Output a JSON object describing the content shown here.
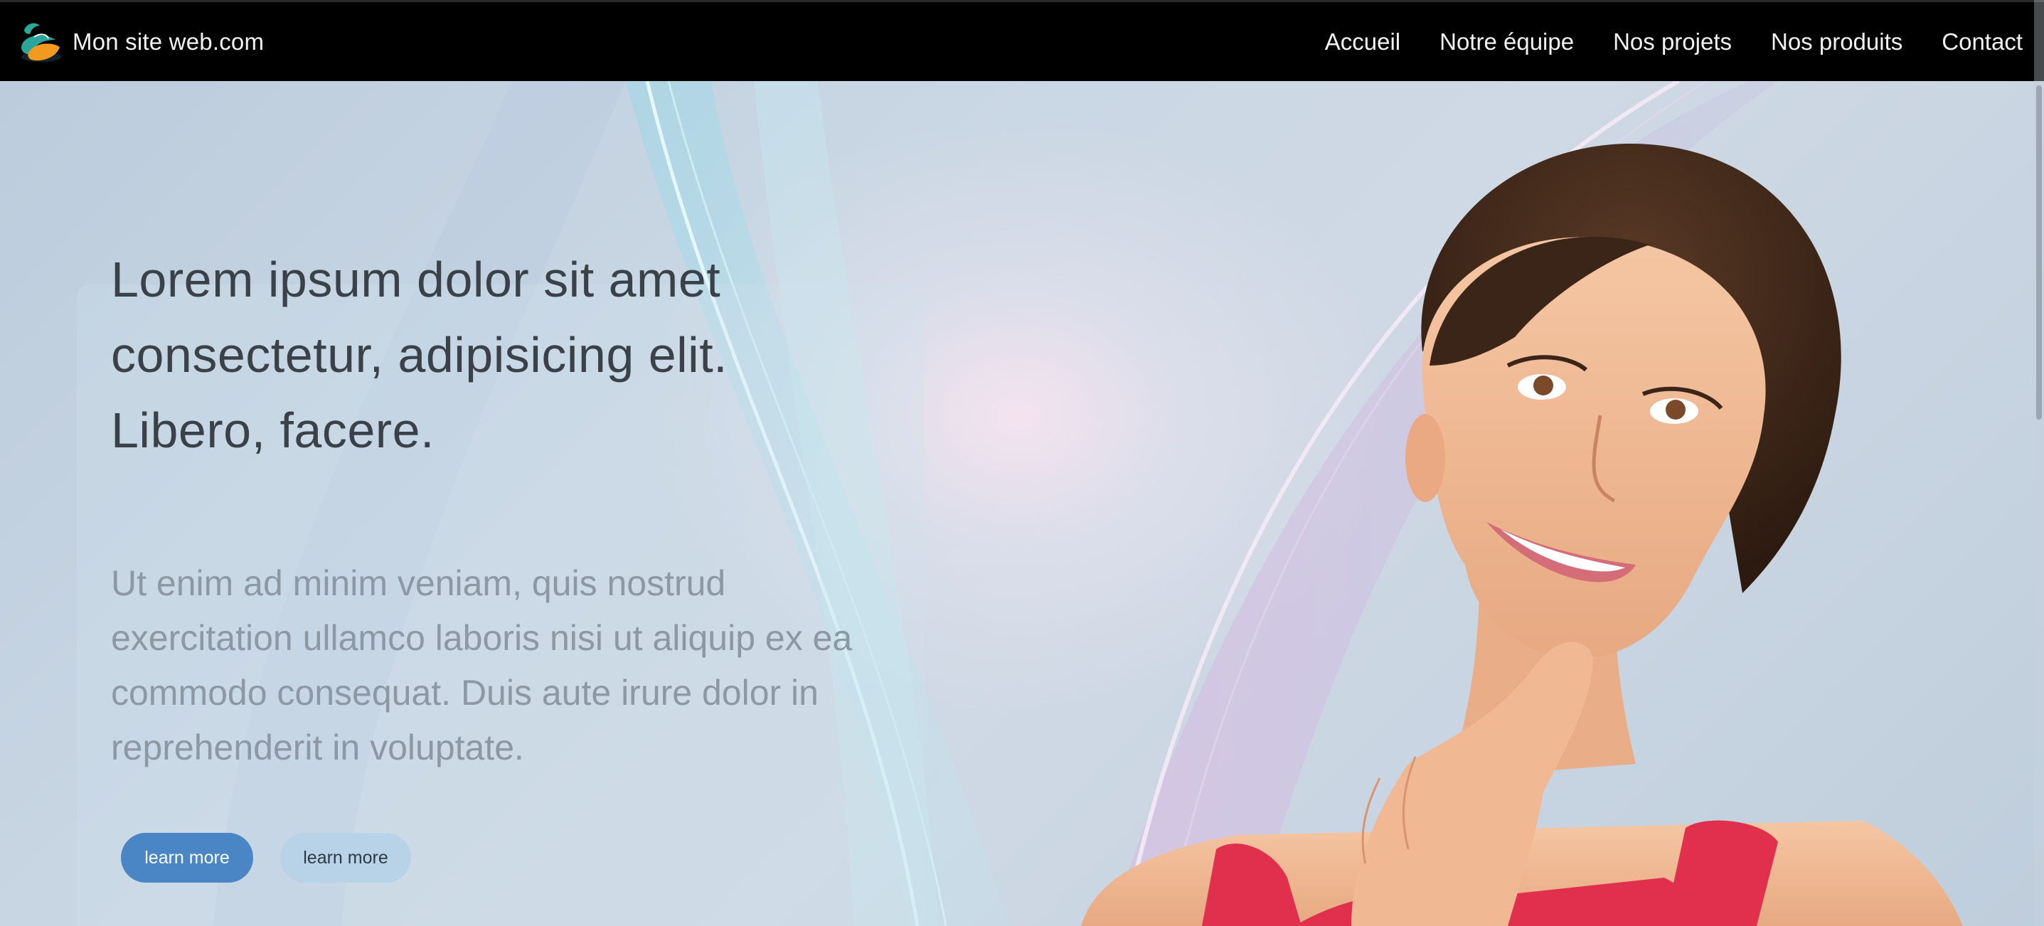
{
  "navbar": {
    "brand_text": "Mon site web.com",
    "logo_icon": "leaf-swirl-logo",
    "links": [
      "Accueil",
      "Notre équipe",
      "Nos projets",
      "Nos produits",
      "Contact"
    ]
  },
  "hero": {
    "title": "Lorem ipsum dolor sit amet consectetur, adipisicing elit. Libero, facere.",
    "text": "Ut enim ad minim veniam, quis nostrud exercitation ullamco laboris nisi ut aliquip ex ea commodo consequat. Duis aute irure dolor in reprehenderit in voluptate.",
    "primary_button": "learn more",
    "secondary_button": "learn more",
    "image": "smiling-woman-photo"
  },
  "colors": {
    "navbar_bg": "#000000",
    "primary_button": "#4a86c5",
    "secondary_button": "#b8d2e7",
    "top_red": "#e0304d"
  }
}
